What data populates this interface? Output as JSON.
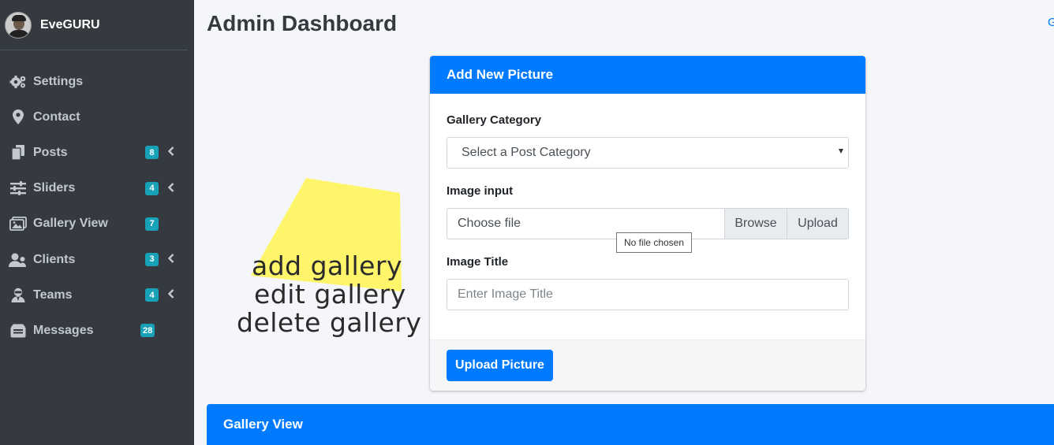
{
  "sidebar": {
    "brand_name": "EveGURU",
    "items": [
      {
        "label": "Settings",
        "icon": "gears-icon"
      },
      {
        "label": "Contact",
        "icon": "map-marker-icon"
      },
      {
        "label": "Posts",
        "icon": "copy-icon",
        "badge": "8"
      },
      {
        "label": "Sliders",
        "icon": "sliders-icon",
        "badge": "4"
      },
      {
        "label": "Gallery View",
        "icon": "images-icon",
        "badge": "7"
      },
      {
        "label": "Clients",
        "icon": "user-group-icon",
        "badge": "3"
      },
      {
        "label": "Teams",
        "icon": "user-secret-icon",
        "badge": "4"
      },
      {
        "label": "Messages",
        "icon": "inbox-icon",
        "badge": "28"
      }
    ]
  },
  "header": {
    "title": "Admin Dashboard",
    "corner_link": "G"
  },
  "form": {
    "title": "Add New Picture",
    "category_label": "Gallery Category",
    "category_selected": "Select a Post Category",
    "image_label": "Image input",
    "file_placeholder": "Choose file",
    "browse_label": "Browse",
    "upload_label": "Upload",
    "tooltip": "No file chosen",
    "title_label": "Image Title",
    "title_placeholder": "Enter Image Title",
    "submit_label": "Upload Picture"
  },
  "gallery_section": {
    "title": "Gallery View"
  },
  "annotation": {
    "lines": [
      "add gallery",
      "edit gallery",
      "delete gallery"
    ]
  },
  "colors": {
    "primary": "#007bff",
    "sidebar_bg": "#343a40",
    "badge": "#17a2b8",
    "sticky_note": "#fff56a"
  }
}
